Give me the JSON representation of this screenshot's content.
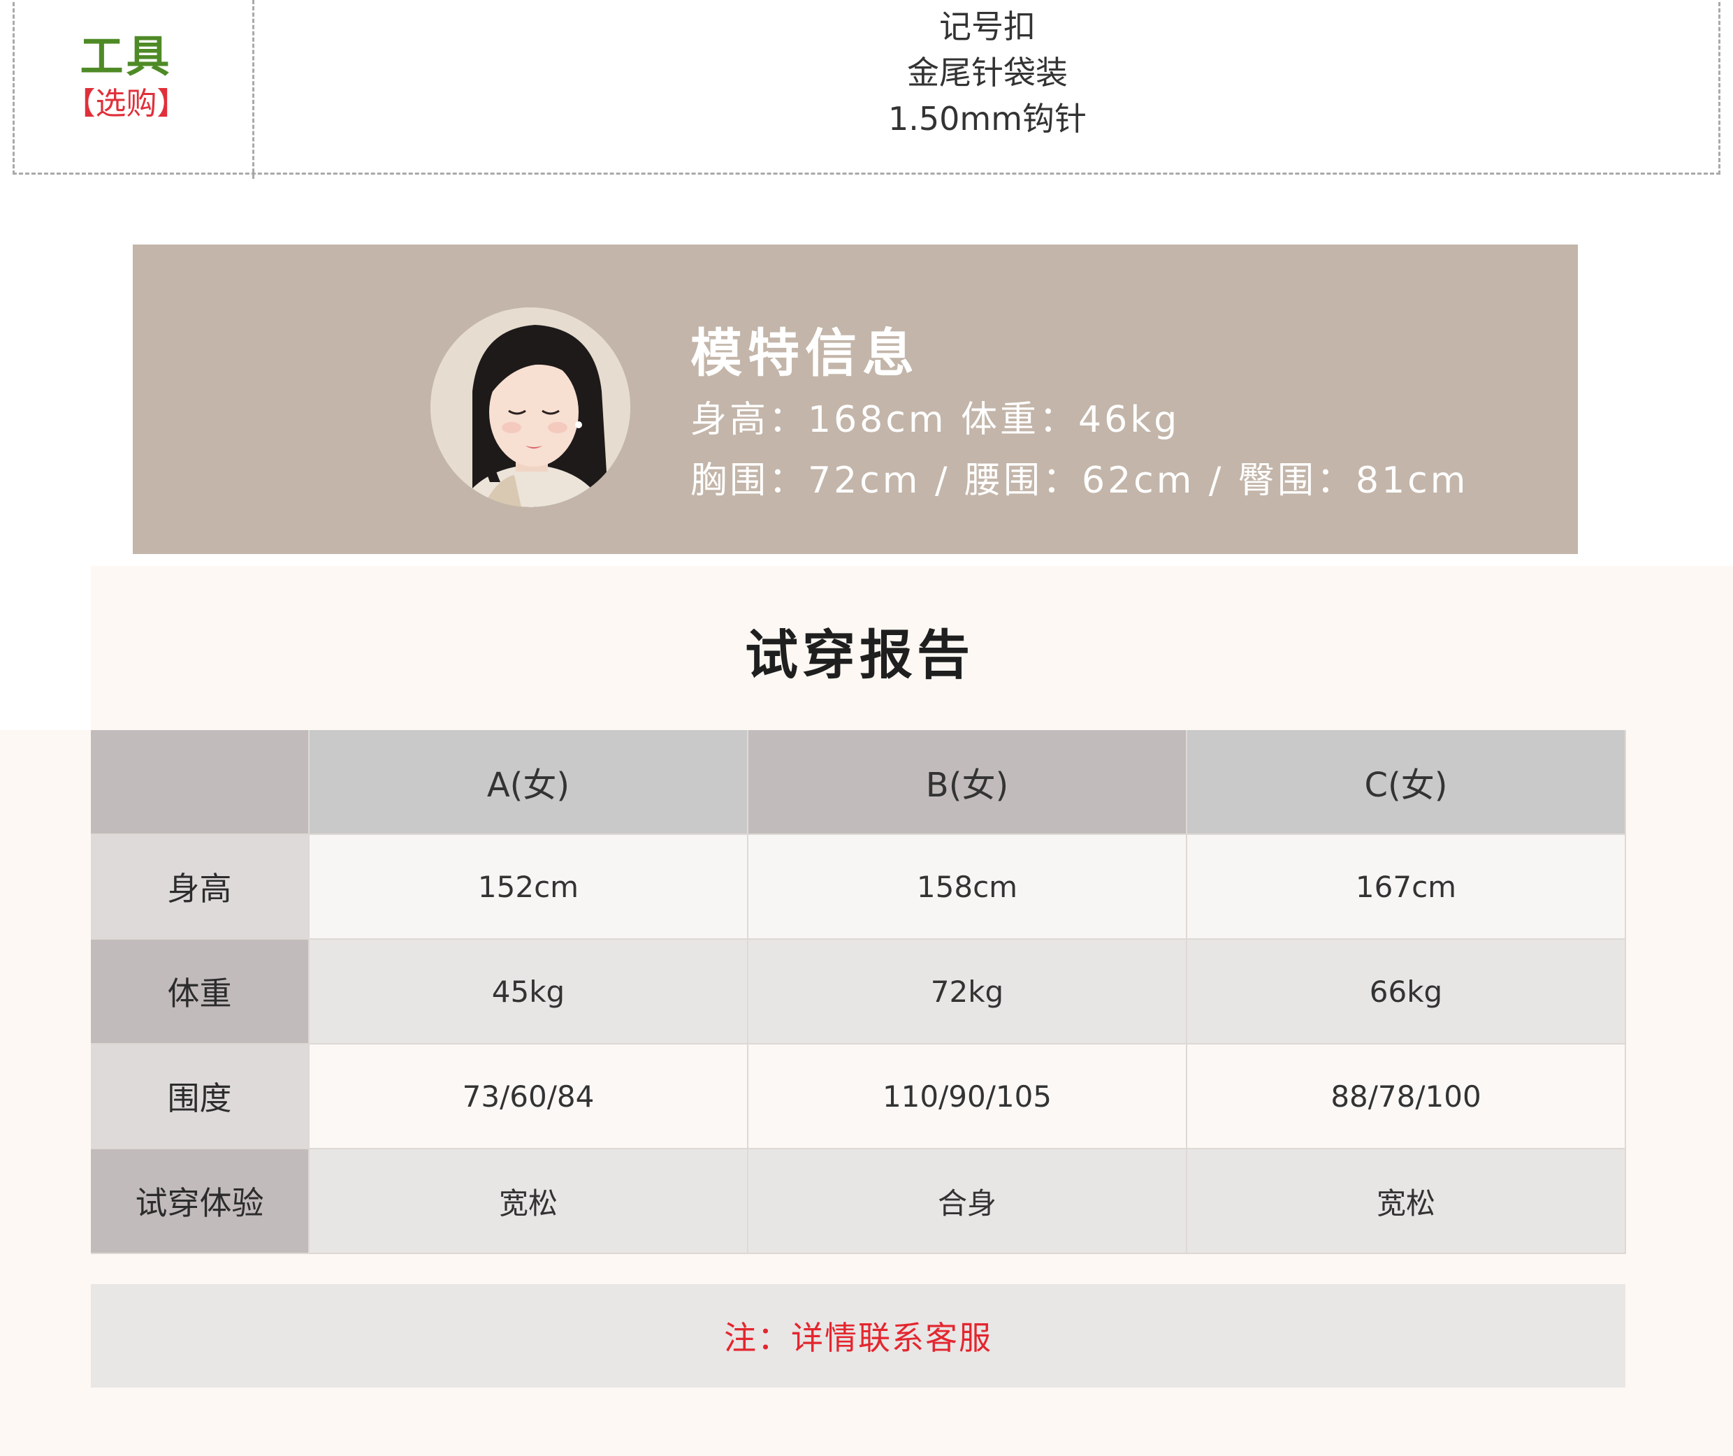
{
  "tools": {
    "label": "工具",
    "sublabel": "【选购】",
    "items": [
      "记号扣",
      "金尾针袋装",
      "1.50mm钩针"
    ]
  },
  "model": {
    "title": "模特信息",
    "line1": "身高：168cm  体重：46kg",
    "line2": "胸围：72cm / 腰围：62cm / 臀围：81cm"
  },
  "report": {
    "title": "试穿报告",
    "columns": [
      "",
      "A(女)",
      "B(女)",
      "C(女)"
    ],
    "rows": [
      {
        "label": "身高",
        "values": [
          "152cm",
          "158cm",
          "167cm"
        ]
      },
      {
        "label": "体重",
        "values": [
          "45kg",
          "72kg",
          "66kg"
        ]
      },
      {
        "label": "围度",
        "values": [
          "73/60/84",
          "110/90/105",
          "88/78/100"
        ]
      },
      {
        "label": "试穿体验",
        "values": [
          "宽松",
          "合身",
          "宽松"
        ]
      }
    ],
    "note": "注：详情联系客服"
  },
  "colors": {
    "tools_label": "#4e8a26",
    "accent_red": "#e3262e",
    "model_card": "#c3b5a9",
    "report_bg": "#fdf8f3"
  }
}
